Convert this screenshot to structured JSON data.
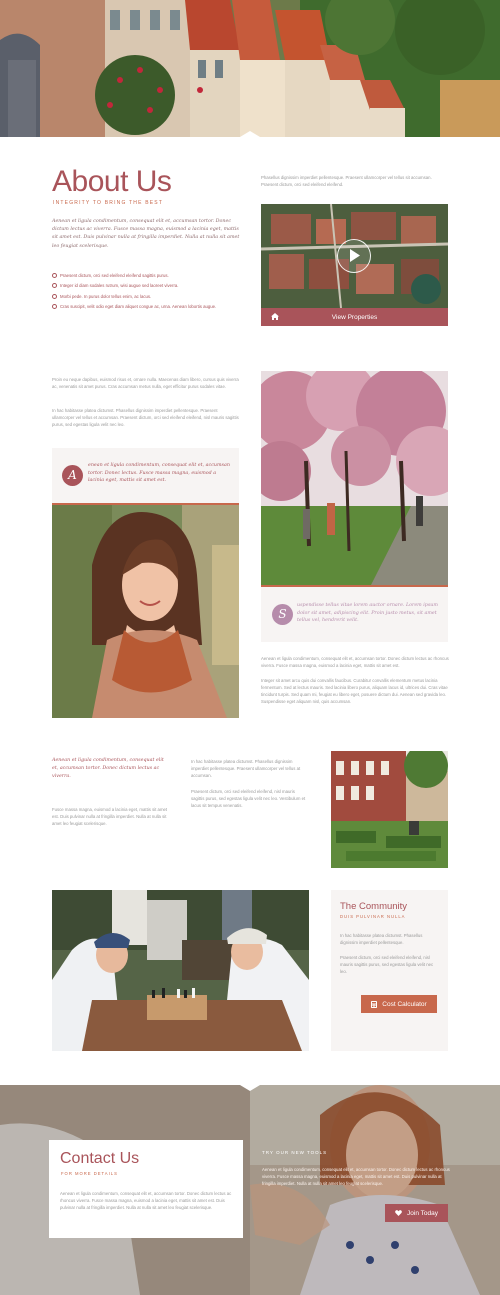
{
  "colors": {
    "accent": "#a9545a",
    "accent_orange": "#c8684c",
    "light_bg": "#f7f4f3"
  },
  "about": {
    "title": "About Us",
    "subtitle": "INTEGRITY TO BRING THE BEST",
    "intro": "Aenean et ligula condimentum, consequat elit et, accumsan tortor. Donec dictum lectus ac viverra. Fusce massa magna, euismod a lacinia eget, mattis sit amet est. Duis pulvinar nulla at fringilla imperdiet. Nulla at nulla sit amet leo feugiat scelerisque.",
    "checklist": [
      "Praesent dictum, orci sed eleifend eleifend sagittis purus.",
      "Integer id diam sodales rutrum, wisi augue sed laoreet viverra.",
      "Morbi pede. In purus dolor tellus enim, ac lacus.",
      "Cras suscipit, velit odio eget diam aliquet congue ac, urna. Aenean lobortis augue."
    ],
    "right_text": "Phasellus dignissim imperdiet pellentesque. Praesent ullamcorper vel tellus sit accumsan. Praesent dictum, orci sed eleifend eleifend.",
    "video_button": "View Properties",
    "video_play_icon": "play-icon",
    "home_icon": "home-icon"
  },
  "story": {
    "para1": "Proin eu neque dapibus, euismod risus et, ornare nulla. Maecenas diam libero, cursus quis viverra ac, venenatis sit amet purus. Cras accumsan metus nulla, eget efficitur purus sodales vitae.",
    "para2": "In hac habitasse platea dictumst. Phasellus dignissim imperdiet pellentesque. Praesent ullamcorper vel tellus et accumsan. Praesent dictum, orci sed eleifend eleifend, nisl mauris sagittis purus, sed egestas ligula velit nec leo.",
    "quote1_letter": "A",
    "quote1": "enean et ligula condimentum, consequat elit et, accumsan tortor. Donec lectus. Fusce massa magna, euismod a lacinia eget, mattis sit amet est.",
    "quote2_letter": "S",
    "quote2": "uspendisse tellus vitae lorem auctor ornare. Lorem ipsum dolor sit amet, adipiscing elit. Proin justo metus, sit amet tellus vel, hendrerit velit.",
    "para3": "Aenean et ligula condimentum, consequat elit et, accumsan tortor. Donec dictum lectus ac rhoncus viverra. Fusce massa magna, euismod a lacinia eget, mattis sit amet est.",
    "para4": "Integer sit amet arcu quis dui convallis faucibus. Curabitur convallis elementum metus lacinia fermentum. Sed at lectus mauris. Sed lacinia libero purus, aliquam lacus id, ultrices dui. Cras vitae tincidunt turpis. Sed quam mi, feugiat eu libero eget, posuere dictum dui. Aenean sed gravida leo. Suspendisse eget aliquam nisl, quis accumsan."
  },
  "middle": {
    "quote": "Aenean et ligula condimentum, consequat elit et, accumsan tortor. Donec dictum lectus ac viverra.",
    "left_text": "Fusce massa magna, euismod a lacinia eget, mattis sit amet est. Duis pulvinar nulla at fringilla imperdiet. Nulla at nulla sit amet leo feugiat scelerisque.",
    "center_text1": "In hac habitasse platea dictumst. Phasellus dignissim imperdiet pellentesque. Praesent ullamcorper vel tellus at accumsan.",
    "center_text2": "Praesent dictum, orci sed eleifend eleifend, nisl mauris sagittis purus, sed egestas ligula velit nec leo. Vestibulum et lacus sit tempus venenatis."
  },
  "community": {
    "title": "The Community",
    "subtitle": "DUIS PULVINAR NULLA",
    "text1": "In hac habitasse platea dictumst. Phasellus dignissim imperdiet pellentesque.",
    "text2": "Praesent dictum, orci sed eleifend eleifend, nisl mauris sagittis purus, sed egestas ligula velit nec leo.",
    "button": "Cost Calculator",
    "button_icon": "calculator-icon"
  },
  "contact": {
    "title": "Contact Us",
    "subtitle": "FOR MORE DETAILS",
    "text": "Aenean et ligula condimentum, consequat elit et, accumsan tortor. Donec dictum lectus ac rhoncus viverra. Fusce massa magna, euismod a lacinia eget, mattis sit amet est. Duis pulvinar nulla at fringilla imperdiet. Nulla at nulla sit amet leo feugiat scelerisque.",
    "try_label": "TRY OUR NEW TOOLS",
    "try_text": "Aenean et ligula condimentum, consequat elit et, accumsan tortor. Donec dictum lectus ac rhoncus viverra. Fusce massa magna, euismod a lacinia eget, mattis sit amet est. Duis pulvinar nulla at fringilla imperdiet. Nulla at nulla sit amet leo feugiat scelerisque.",
    "button": "Join Today",
    "button_icon": "heart-icon"
  }
}
